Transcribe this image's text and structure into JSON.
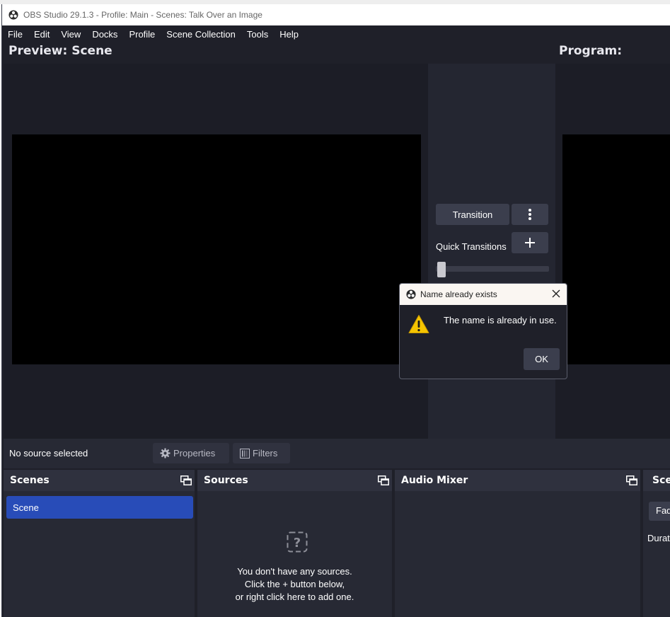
{
  "window": {
    "title": "OBS Studio 29.1.3 - Profile: Main - Scenes: Talk Over an Image"
  },
  "menu": [
    "File",
    "Edit",
    "View",
    "Docks",
    "Profile",
    "Scene Collection",
    "Tools",
    "Help"
  ],
  "preview": {
    "title": "Preview: Scene"
  },
  "program": {
    "title": "Program:"
  },
  "transition_panel": {
    "transition_label": "Transition",
    "quick_transitions_label": "Quick Transitions",
    "tbar_fraction": 0.0
  },
  "context_bar": {
    "no_source_label": "No source selected",
    "properties_label": "Properties",
    "filters_label": "Filters"
  },
  "docks": {
    "scenes": {
      "title": "Scenes",
      "items": [
        "Scene"
      ]
    },
    "sources": {
      "title": "Sources",
      "empty_lines": [
        "You don't have any sources.",
        "Click the + button below,",
        "or right click here to add one."
      ]
    },
    "audio_mixer": {
      "title": "Audio Mixer"
    },
    "scene_transitions": {
      "title": "Scene Transitions",
      "select_value": "Fade",
      "duration_label": "Duration"
    }
  },
  "dialog": {
    "title": "Name already exists",
    "message": "The name is already in use.",
    "ok_label": "OK"
  },
  "colors": {
    "window_bg": "#1f2029",
    "panel_bg": "#272934",
    "button_bg": "#3b3e4d",
    "selected_scene": "#284cb8",
    "warning": "#f5c400"
  },
  "icons": {
    "app": "obs-logo-icon",
    "more": "vertical-dots-icon",
    "add": "plus-icon",
    "properties": "gear-icon",
    "filters": "filter-icon",
    "undock": "undock-icon",
    "empty_sources": "question-icon",
    "warning": "warning-icon",
    "close": "close-icon"
  }
}
